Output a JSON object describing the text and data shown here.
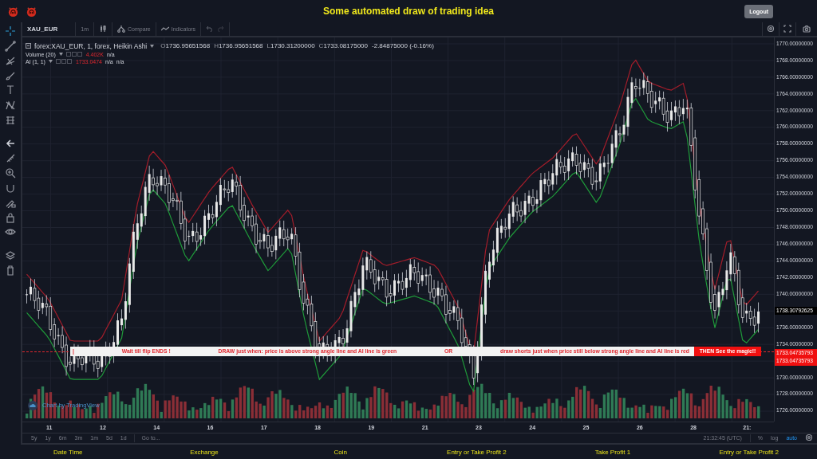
{
  "header": {
    "title": "Some automated draw of trading idea",
    "logout": "Logout"
  },
  "toolbar": {
    "symbol": "XAU_EUR",
    "interval": "1m",
    "compare": "Compare",
    "indicators": "Indicators"
  },
  "legend": {
    "title": "forex:XAU_EUR, 1, forex, Heikin Ashi",
    "ohlc": [
      {
        "label": "O",
        "value": "1736.95651568"
      },
      {
        "label": "H",
        "value": "1736.95651568"
      },
      {
        "label": "L",
        "value": "1730.31200000"
      },
      {
        "label": "C",
        "value": "1733.08175000"
      }
    ],
    "change": "-2.84875000 (-0.16%)",
    "studies": [
      {
        "name": "Volume (20)",
        "value": "4.402K",
        "readings": [
          "n/a"
        ]
      },
      {
        "name": "AI (1, 1)",
        "value": "1733.0474",
        "readings": [
          "n/a",
          "n/a"
        ]
      }
    ]
  },
  "price_axis": {
    "items": [
      {
        "kind": "tick",
        "label": "1770.00000000"
      },
      {
        "kind": "tick",
        "label": "1768.00000000"
      },
      {
        "kind": "tick",
        "label": "1766.00000000"
      },
      {
        "kind": "tick",
        "label": "1764.00000000"
      },
      {
        "kind": "tick",
        "label": "1762.00000000"
      },
      {
        "kind": "tick",
        "label": "1760.00000000"
      },
      {
        "kind": "tick",
        "label": "1758.00000000"
      },
      {
        "kind": "tick",
        "label": "1756.00000000"
      },
      {
        "kind": "tick",
        "label": "1754.00000000"
      },
      {
        "kind": "tick",
        "label": "1752.00000000"
      },
      {
        "kind": "tick",
        "label": "1750.00000000"
      },
      {
        "kind": "tick",
        "label": "1748.00000000"
      },
      {
        "kind": "tick",
        "label": "1746.00000000"
      },
      {
        "kind": "tick",
        "label": "1744.00000000"
      },
      {
        "kind": "tick",
        "label": "1742.00000000"
      },
      {
        "kind": "tick",
        "label": "1740.00000000"
      },
      {
        "kind": "last",
        "label": "1738.30792625"
      },
      {
        "kind": "tick",
        "label": "1736.00000000"
      },
      {
        "kind": "tick",
        "label": "1734.00000000"
      },
      {
        "kind": "alert",
        "label": "1733.04735793"
      },
      {
        "kind": "alert",
        "label": "1733.04735793"
      },
      {
        "kind": "tick",
        "label": "1730.00000000"
      },
      {
        "kind": "tick",
        "label": "1728.00000000"
      },
      {
        "kind": "tick",
        "label": "1726.00000000"
      }
    ]
  },
  "banner": {
    "segments": [
      "|",
      "Wait till flip ENDS  !",
      "DRAW just when:  price is above strong angle line and AI line is green",
      "OR",
      "draw shorts just when price still below strong angle line and AI line is red"
    ],
    "button": "THEN See the magic!!"
  },
  "branding": "Chart by TradingView",
  "time_axis": {
    "labels": [
      "11",
      "12",
      "14",
      "16",
      "17",
      "18",
      "19",
      "21",
      "23",
      "24",
      "25",
      "26",
      "28",
      "21:"
    ]
  },
  "ranges": [
    {
      "label": "5y"
    },
    {
      "label": "1y"
    },
    {
      "label": "6m"
    },
    {
      "label": "3m"
    },
    {
      "label": "1m"
    },
    {
      "label": "5d"
    },
    {
      "label": "1d"
    }
  ],
  "goto": "Go to...",
  "status": {
    "time": "21:32:45 (UTC)",
    "options": [
      {
        "label": "%",
        "selected": false
      },
      {
        "label": "log",
        "selected": false
      },
      {
        "label": "auto",
        "selected": true
      }
    ]
  },
  "footer": {
    "labels": [
      "Date Time",
      "Exchange",
      "Coin",
      "Entry or Take Profit 2",
      "Take Profit 1",
      "Entry or Take Profit 2"
    ]
  }
}
